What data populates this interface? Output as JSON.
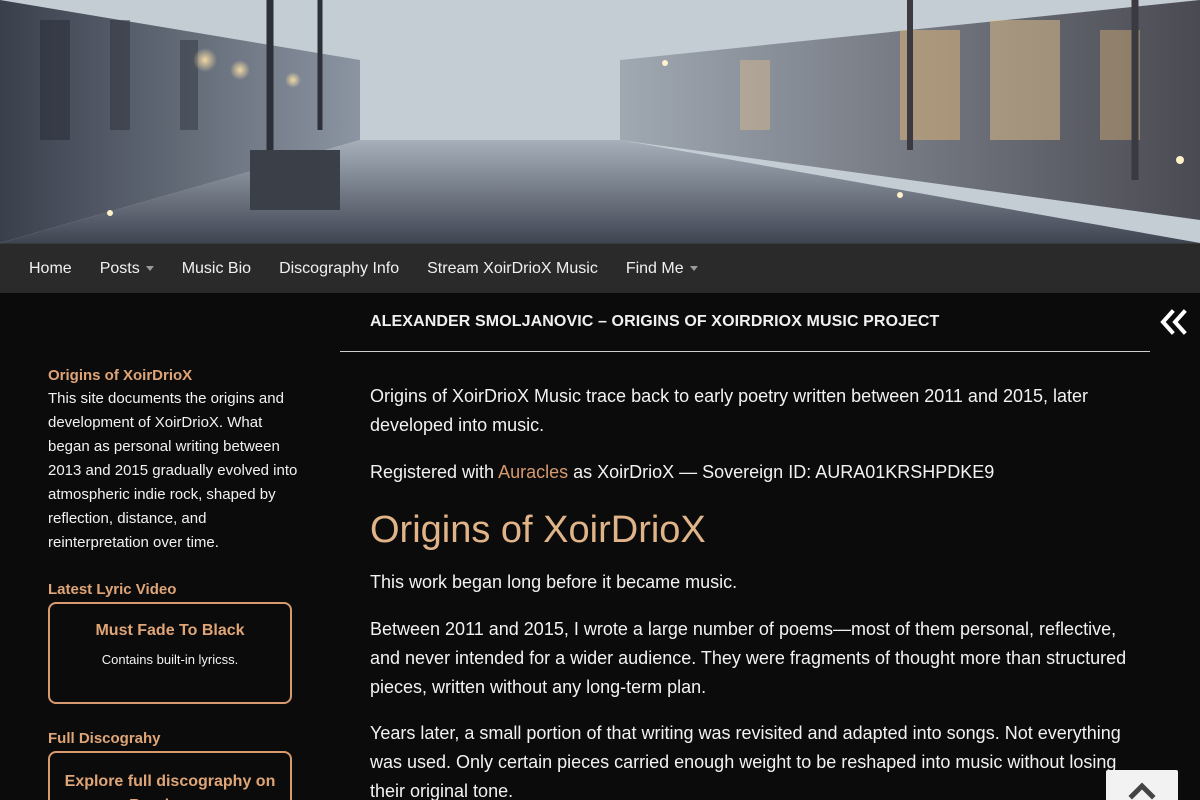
{
  "nav": {
    "items": [
      {
        "label": "Home",
        "dropdown": false
      },
      {
        "label": "Posts",
        "dropdown": true
      },
      {
        "label": "Music Bio",
        "dropdown": false
      },
      {
        "label": "Discography Info",
        "dropdown": false
      },
      {
        "label": "Stream XoirDrioX Music",
        "dropdown": false
      },
      {
        "label": "Find Me",
        "dropdown": true
      }
    ]
  },
  "sidebar": {
    "about_title": "Origins of XoirDrioX",
    "about_text": "This site documents the origins and development of XoirDrioX. What began as personal writing between 2013 and 2015 gradually evolved into atmospheric indie rock, shaped by reflection, distance, and reinterpretation over time.",
    "video_title": "Latest Lyric Video",
    "video_card_title": "Must Fade To Black",
    "video_card_sub": "Contains built-in lyricss.",
    "discography_title": "Full Discograhy",
    "discography_card_title": "Explore full discography on Bandcamp"
  },
  "main": {
    "heading": "ALEXANDER SMOLJANOVIC – ORIGINS OF XOIRDRIOX MUSIC PROJECT",
    "intro": "Origins of XoirDrioX Music trace back to early poetry written between 2011 and 2015, later developed into music.",
    "registered_prefix": "Registered with ",
    "registered_link": "Auracles",
    "registered_suffix": " as XoirDrioX — Sovereign ID: AURA01KRSHPDKE9",
    "h1": "Origins of XoirDrioX",
    "p1": "This work began long before it became music.",
    "p2": "Between 2011 and 2015, I wrote a large number of poems—most of them personal, reflective, and never intended for a wider audience. They were fragments of thought more than structured pieces, written without any long-term plan.",
    "p3": "Years later, a small portion of that writing was revisited and adapted into songs. Not everything was used. Only certain pieces carried enough weight to be reshaped into music without losing their original tone."
  },
  "icons": {
    "collapse": "double-chevron-left-icon",
    "scroll_top": "chevron-up-icon"
  },
  "colors": {
    "accent": "#d69a6e",
    "heading_accent": "#e0b488",
    "nav_bg": "#2a2a2a",
    "page_bg": "#0b0b0b"
  }
}
